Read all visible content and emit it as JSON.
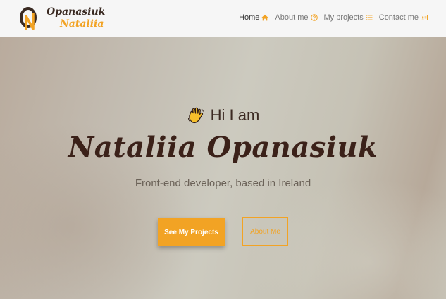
{
  "brand": {
    "line1": "Opanasiuk",
    "line2": "Nataliia",
    "logo_icon": "logo-on-monogram"
  },
  "nav": {
    "items": [
      {
        "label": "Home",
        "icon": "home-icon",
        "active": true
      },
      {
        "label": "About me",
        "icon": "question-circle-icon",
        "active": false
      },
      {
        "label": "My projects",
        "icon": "list-icon",
        "active": false
      },
      {
        "label": "Contact me",
        "icon": "contact-card-icon",
        "active": false
      }
    ]
  },
  "hero": {
    "greeting": "Hi I am",
    "greeting_icon": "waving-hand-icon",
    "name": "Nataliia Opanasiuk",
    "subtitle": "Front-end developer, based in Ireland",
    "primary_button": "See My Projects",
    "secondary_button": "About Me"
  },
  "colors": {
    "accent": "#f2a324",
    "dark_brown": "#3b2119"
  }
}
